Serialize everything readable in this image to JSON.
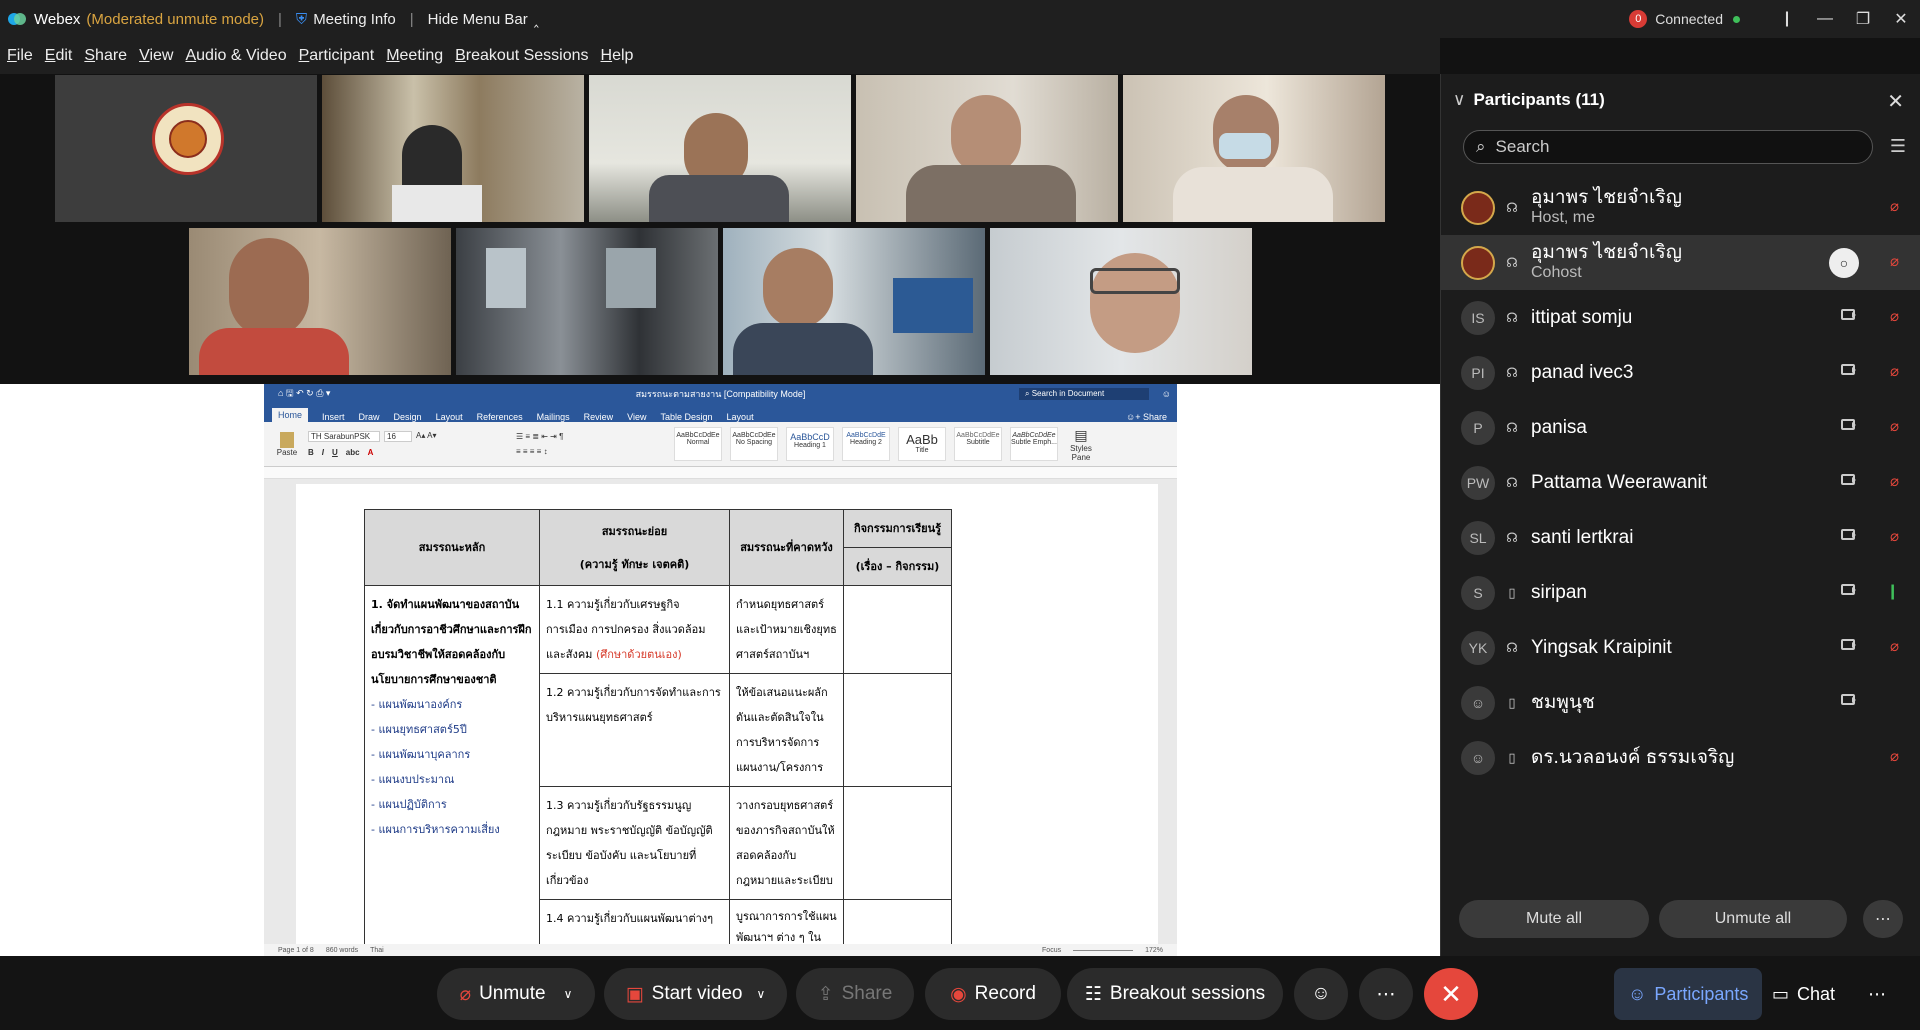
{
  "titlebar": {
    "app_name": "Webex",
    "app_status": "(Moderated unmute mode)",
    "meeting_info": "Meeting Info",
    "hide_menu": "Hide Menu Bar",
    "connection_badge": "0",
    "connection": "Connected"
  },
  "menu": [
    "File",
    "Edit",
    "Share",
    "View",
    "Audio & Video",
    "Participant",
    "Meeting",
    "Breakout Sessions",
    "Help"
  ],
  "word": {
    "doc_title": "สมรรถนะตามสายงาน [Compatibility Mode]",
    "search_placeholder": "Search in Document",
    "tabs": [
      "Home",
      "Insert",
      "Draw",
      "Design",
      "Layout",
      "References",
      "Mailings",
      "Review",
      "View",
      "Table Design",
      "Layout"
    ],
    "share": "Share",
    "font": "TH SarabunPSK",
    "size": "16",
    "paste": "Paste",
    "styles": [
      "Normal",
      "No Spacing",
      "Heading 1",
      "Heading 2",
      "Title",
      "Subtitle",
      "Subtle Emph..."
    ],
    "style_previews": [
      "AaBbCcDdEe",
      "AaBbCcDdEe",
      "AaBbCcD",
      "AaBbCcDdE",
      "AaBb",
      "AaBbCcDdEe",
      "AaBbCcDdEe"
    ],
    "styles_pane": "Styles Pane",
    "status_page": "Page 1 of 8",
    "status_words": "860 words",
    "status_lang": "Thai",
    "status_focus": "Focus",
    "status_zoom": "172%"
  },
  "doc_table": {
    "h1": "สมรรถนะหลัก",
    "h2_line1": "สมรรถนะย่อย",
    "h2_line2": "(ความรู้ ทักษะ เจตคติ)",
    "h3": "สมรรถนะที่คาดหวัง",
    "h4_line1": "กิจกรรมการเรียนรู้",
    "h4_line2": "(เรื่อง – กิจกรรม)",
    "main": "1. จัดทำแผนพัฒนาของสถาบันเกี่ยวกับการอาชีวศึกษาและการฝึกอบรมวิชาชีพให้สอดคล้องกับนโยบายการศึกษาของชาติ",
    "plans": [
      "- แผนพัฒนาองค์กร",
      "- แผนยุทธศาสตร์5ปี",
      "- แผนพัฒนาบุคลากร",
      "- แผนงบประมาณ",
      "- แผนปฏิบัติการ",
      "- แผนการบริหารความเสี่ยง"
    ],
    "sub1": "1.1 ความรู้เกี่ยวกับเศรษฐกิจ การเมือง การปกครอง สิ่งแวดล้อม และสังคม",
    "sub1_note": "(ศึกษาด้วยตนเอง)",
    "sub2": "1.2 ความรู้เกี่ยวกับการจัดทำและการบริหารแผนยุทธศาสตร์",
    "sub3": "1.3 ความรู้เกี่ยวกับรัฐธรรมนูญ กฎหมาย พระราชบัญญัติ ข้อบัญญัติ ระเบียบ ข้อบังคับ และนโยบายที่เกี่ยวข้อง",
    "sub4": "1.4 ความรู้เกี่ยวกับแผนพัฒนาต่างๆ",
    "exp1": "กำหนดยุทธศาสตร์ และเป้าหมายเชิงยุทธศาสตร์สถาบันฯ",
    "exp2": "ให้ข้อเสนอแนะผลักดันและตัดสินใจในการบริหารจัดการแผนงาน/โครงการ",
    "exp3": "วางกรอบยุทธศาสตร์ของภารกิจสถาบันให้สอดคล้องกับกฎหมายและระเบียบ",
    "exp4": "บูรณาการการใช้แผนพัฒนาฯ ต่าง ๆ ในการกำหนด"
  },
  "sidebar": {
    "title": "Participants (11)",
    "search_placeholder": "Search",
    "participants": [
      {
        "name": "อุมาพร ไชยจำเริญ",
        "role": "Host, me",
        "initials": "",
        "mic": "muted"
      },
      {
        "name": "อุมาพร ไชยจำเริญ",
        "role": "Cohost",
        "initials": "",
        "mic": "muted"
      },
      {
        "name": "ittipat somju",
        "role": "",
        "initials": "IS",
        "mic": "muted"
      },
      {
        "name": "panad ivec3",
        "role": "",
        "initials": "PI",
        "mic": "muted"
      },
      {
        "name": "panisa",
        "role": "",
        "initials": "P",
        "mic": "muted"
      },
      {
        "name": "Pattama Weerawanit",
        "role": "",
        "initials": "PW",
        "mic": "muted"
      },
      {
        "name": "santi lertkrai",
        "role": "",
        "initials": "SL",
        "mic": "muted"
      },
      {
        "name": "siripan",
        "role": "",
        "initials": "S",
        "mic": "on"
      },
      {
        "name": "Yingsak Kraipinit",
        "role": "",
        "initials": "YK",
        "mic": "muted"
      },
      {
        "name": "ชมพูนุช",
        "role": "",
        "initials": "",
        "mic": "none"
      },
      {
        "name": "ดร.นวลอนงค์ ธรรมเจริญ",
        "role": "",
        "initials": "",
        "mic": "muted"
      }
    ],
    "mute_all": "Mute all",
    "unmute_all": "Unmute all"
  },
  "toolbar": {
    "unmute": "Unmute",
    "start_video": "Start video",
    "share": "Share",
    "record": "Record",
    "breakout": "Breakout sessions",
    "participants": "Participants",
    "chat": "Chat"
  },
  "colors": {
    "accent": "#7aa7ff",
    "danger": "#e5473c",
    "word_blue": "#2b579a",
    "connected": "#3fbf5a"
  }
}
